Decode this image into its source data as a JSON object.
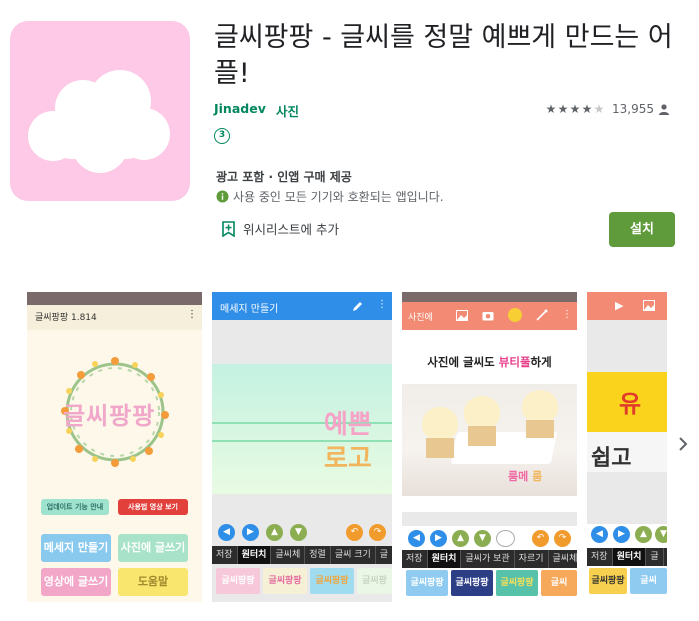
{
  "app": {
    "title": "글씨팡팡 - 글씨를 정말 예쁘게 만드는 어플!",
    "developer": "Jinadev",
    "category": "사진",
    "rating_stars": 4,
    "rating_count": "13,955",
    "age_badge": "③",
    "ads_note": "광고 포함 · 인앱 구매 제공",
    "compat_note": "사용 중인 모든 기기와 호환되는 앱입니다.",
    "wishlist_label": "위시리스트에 추가",
    "install_label": "설치",
    "icon_bg_color": "#fdc9e6",
    "accent_color": "#01875f",
    "install_color": "#5f9b3a"
  },
  "screens": {
    "s1": {
      "status": "글씨팡팡 1.814",
      "menu": "⋮",
      "logo_text": "글씨팡팡",
      "btn_update": "업데이트 기능 안내",
      "btn_video": "사용법 영상 보기",
      "btn_message": "메세지 만들기",
      "btn_photo": "사진에 글쓰기",
      "btn_video_write": "영상에 글쓰기",
      "btn_help": "도움말"
    },
    "s2": {
      "title": "메세지 만들기",
      "menu": "⋮",
      "text_line1": "예쁜",
      "text_line2": "로고",
      "tabs": [
        "저장",
        "원터치",
        "글씨체",
        "정렬",
        "글씨 크기",
        "글"
      ],
      "samples": [
        "글씨팡팡",
        "글씨팡팡",
        "글씨팡팡",
        "글씨팡"
      ]
    },
    "s3": {
      "title": "사진에",
      "menu": "⋮",
      "headline_a": "사진에 글씨도 ",
      "headline_b": "뷰티풀",
      "headline_c": "하게",
      "photo_text": "룸메 ",
      "photo_text2": "룸",
      "tabs": [
        "저장",
        "원터치",
        "글씨가 보관",
        "자르기",
        "글씨체"
      ],
      "samples": [
        "글씨팡팡",
        "글씨팡팡",
        "글씨팡팡",
        "글씨"
      ]
    },
    "s4": {
      "text_top": "유",
      "text_bottom": "쉽고",
      "tabs": [
        "저장",
        "원터치",
        "글"
      ],
      "samples": [
        "글씨팡팡",
        "글씨"
      ]
    }
  }
}
